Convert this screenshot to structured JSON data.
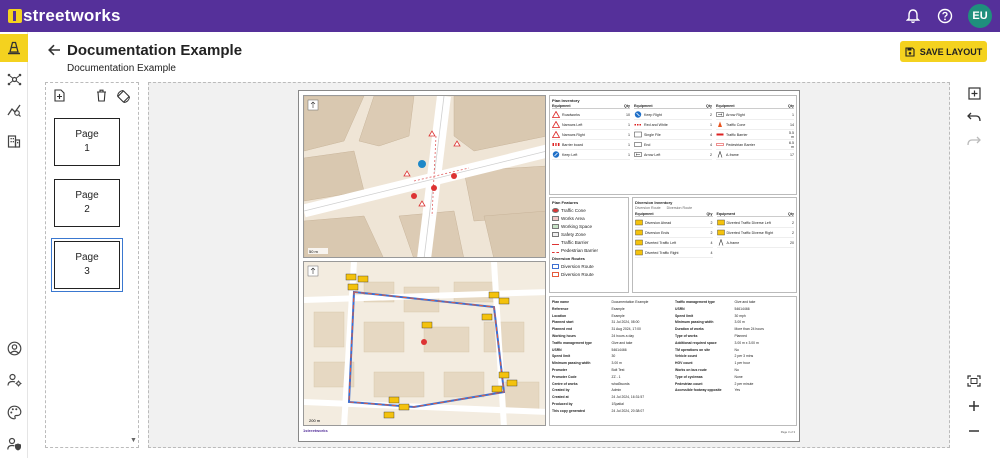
{
  "app": {
    "logo_text": "streetworks",
    "avatar_initials": "EU",
    "brand_color": "#55309a",
    "accent_color": "#f4d21f",
    "icons": [
      "bell-icon",
      "help-icon"
    ]
  },
  "nav": {
    "items": [
      {
        "icon": "traffic-cone-icon",
        "active": true
      },
      {
        "icon": "network-icon",
        "active": false
      },
      {
        "icon": "analytics-icon",
        "active": false
      },
      {
        "icon": "building-icon",
        "active": false
      },
      {
        "icon": "account-icon",
        "active": false
      },
      {
        "icon": "user-settings-icon",
        "active": false
      },
      {
        "icon": "palette-icon",
        "active": false
      },
      {
        "icon": "admin-icon",
        "active": false
      }
    ]
  },
  "header": {
    "title": "Documentation Example",
    "subtitle": "Documentation Example",
    "save_label": "SAVE LAYOUT"
  },
  "pages": [
    {
      "label": "Page\n1",
      "line1": "Page",
      "line2": "1"
    },
    {
      "label": "Page\n2",
      "line1": "Page",
      "line2": "2"
    },
    {
      "label": "Page\n3",
      "line1": "Page",
      "line2": "3",
      "selected": true
    }
  ],
  "sheet": {
    "inventory": {
      "title": "Plan Inventory",
      "col_equipment": "Equipment",
      "col_qty": "Qty",
      "columns": [
        [
          {
            "name": "Roadworks",
            "qty": "10"
          },
          {
            "name": "Narrows Left",
            "qty": "1"
          },
          {
            "name": "Narrows Right",
            "qty": "1"
          },
          {
            "name": "Barrier board",
            "qty": "1"
          },
          {
            "name": "Keep Left",
            "qty": "1"
          }
        ],
        [
          {
            "name": "Keep Right",
            "qty": "2"
          },
          {
            "name": "Red and White",
            "qty": "1"
          },
          {
            "name": "Single File",
            "qty": "4"
          },
          {
            "name": "End",
            "qty": "4"
          },
          {
            "name": "Arrow Left",
            "qty": "2"
          }
        ],
        [
          {
            "name": "Arrow Right",
            "qty": "1"
          },
          {
            "name": "Traffic Cone",
            "qty": "14"
          },
          {
            "name": "Traffic Barrier",
            "qty": "5.5 m"
          },
          {
            "name": "Pedestrian Barrier",
            "qty": "6.5 m"
          },
          {
            "name": "A-frame",
            "qty": "17"
          }
        ]
      ]
    },
    "features": {
      "title": "Plan Features",
      "items": [
        "Traffic Cone",
        "Works Area",
        "Working Space",
        "Safety Zone",
        "Traffic Barrier",
        "Pedestrian Barrier"
      ],
      "diversion_title": "Diversion Routes",
      "diversion_items": [
        "Diversion Route",
        "Diversion Route"
      ]
    },
    "diversion_inventory": {
      "title": "Diversion Inventory",
      "legend": [
        "Diversion Route",
        "Diversion Route"
      ],
      "columns": [
        [
          {
            "name": "Diversion Ahead",
            "qty": "2"
          },
          {
            "name": "Diversion Ends",
            "qty": "2"
          },
          {
            "name": "Diverted Traffic Left",
            "qty": "4"
          },
          {
            "name": "Diverted Traffic Right",
            "qty": "4"
          }
        ],
        [
          {
            "name": "Diverted Traffic Diverse Left",
            "qty": "2"
          },
          {
            "name": "Diverted Traffic Diverse Right",
            "qty": "2"
          },
          {
            "name": "A-frame",
            "qty": "20"
          }
        ]
      ]
    },
    "details_left": [
      {
        "k": "Plan name",
        "v": "Documentation Example"
      },
      {
        "k": "Reference",
        "v": "Example"
      },
      {
        "k": "Location",
        "v": "Example"
      },
      {
        "k": "Planned start",
        "v": "31 Jul 2024, 08:00"
      },
      {
        "k": "Planned end",
        "v": "31 Aug 2024, 17:00"
      },
      {
        "k": "Working hours",
        "v": "24 hours a day"
      },
      {
        "k": "Traffic management type",
        "v": "Give and take"
      },
      {
        "k": "USRN",
        "v": "54614466"
      },
      {
        "k": "Speed limit",
        "v": "30"
      },
      {
        "k": "Minimum passing width",
        "v": "3.00 m"
      },
      {
        "k": "Promoter",
        "v": "Bolt Test"
      },
      {
        "k": "Promoter Code",
        "v": "ZZ - 1"
      },
      {
        "k": "Centre of works",
        "v": "what3words"
      },
      {
        "k": "Created by",
        "v": "Admin"
      },
      {
        "k": "Created at",
        "v": "24 Jul 2024, 16:31:57"
      },
      {
        "k": "Produced by",
        "v": "1Spatial"
      },
      {
        "k": "This copy generated",
        "v": "24 Jul 2024, 20:38:07"
      }
    ],
    "details_right": [
      {
        "k": "Traffic management type",
        "v": "Give and take"
      },
      {
        "k": "USRN",
        "v": "54614466"
      },
      {
        "k": "Speed limit",
        "v": "30 mph"
      },
      {
        "k": "Minimum passing width",
        "v": "3.00 m"
      },
      {
        "k": "Duration of works",
        "v": "More than 24 hours"
      },
      {
        "k": "Type of works",
        "v": "Planned"
      },
      {
        "k": "Additional required space",
        "v": "3.00 m x 3.00 m"
      },
      {
        "k": "TM operations on site",
        "v": "No"
      },
      {
        "k": "Vehicle count",
        "v": "2 per 3 mins"
      },
      {
        "k": "HGV count",
        "v": "1 per hour"
      },
      {
        "k": "Works on bus route",
        "v": "No"
      },
      {
        "k": "Type of cyclewas",
        "v": "None"
      },
      {
        "k": "Pedestrian count",
        "v": "2 per minute"
      },
      {
        "k": "Accessible footway opposite",
        "v": "Yes"
      }
    ],
    "footer_logo": "1streetworks",
    "footer_page": "Page 3 of 3"
  }
}
